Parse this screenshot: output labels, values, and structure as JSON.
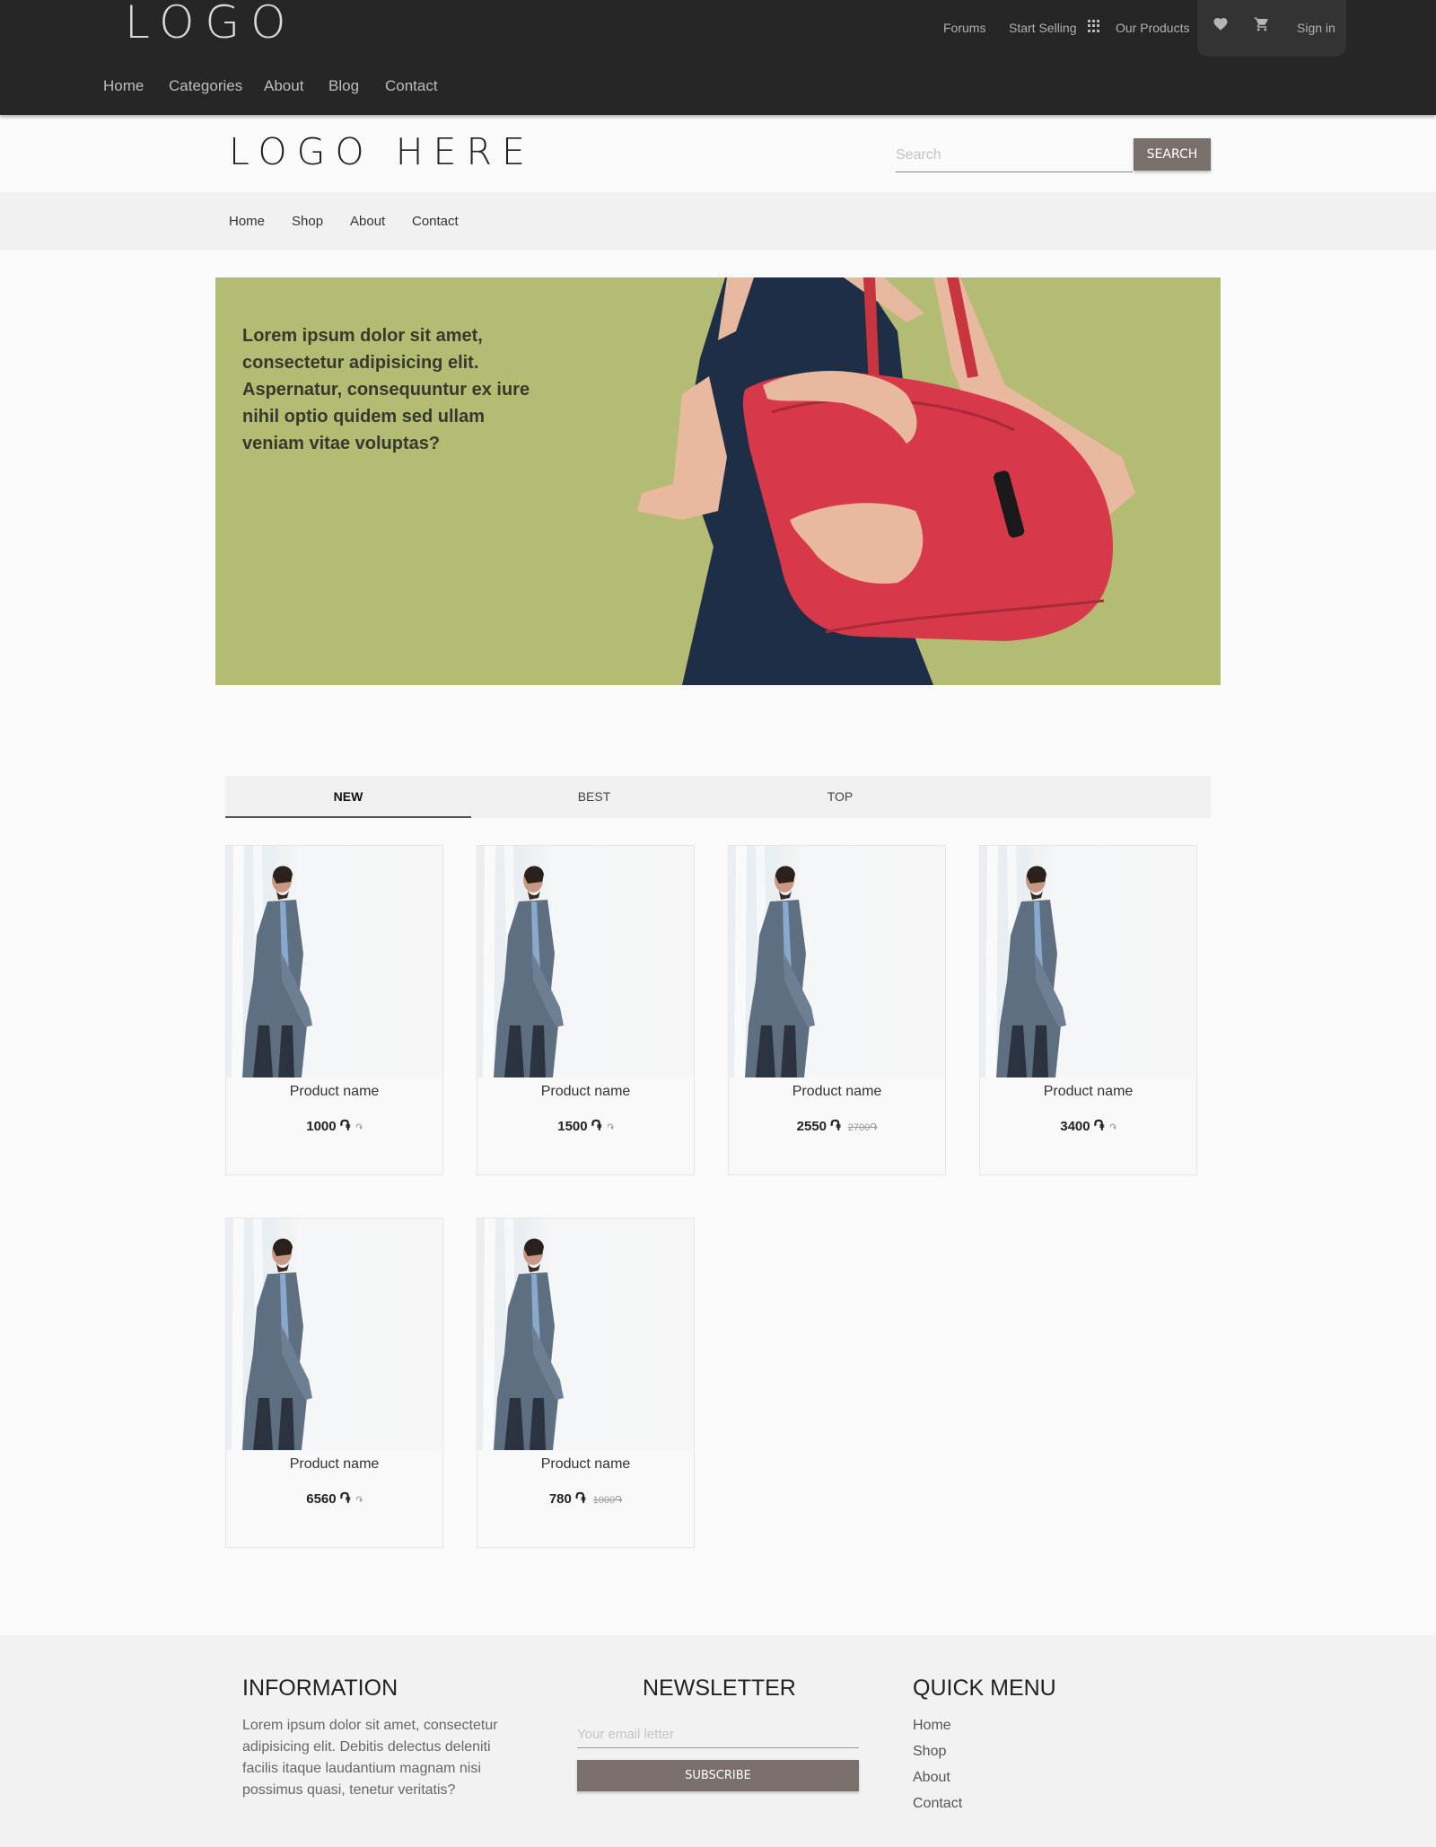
{
  "topbar": {
    "logo": "LOGO",
    "links": {
      "forums": "Forums",
      "start_selling": "Start Selling",
      "our_products": "Our Products",
      "sign_in": "Sign in"
    },
    "icons": [
      "apps-grid-icon",
      "heart-icon",
      "cart-icon"
    ],
    "nav": [
      "Home",
      "Categories",
      "About",
      "Blog",
      "Contact"
    ]
  },
  "header": {
    "logo": "LOGO HERE",
    "search_placeholder": "Search",
    "search_button": "SEARCH"
  },
  "subnav": [
    "Home",
    "Shop",
    "About",
    "Contact"
  ],
  "hero": {
    "text": "Lorem ipsum dolor sit amet, consectetur adipisicing elit. Aspernatur, consequuntur ex iure nihil optio quidem sed ullam veniam vitae voluptas?",
    "background_color": "#b4bb73"
  },
  "tabs": [
    "NEW",
    "BEST",
    "TOP"
  ],
  "active_tab": "NEW",
  "currency_symbol": "֏",
  "products": [
    {
      "name": "Product name",
      "price": "1000",
      "old_price": ""
    },
    {
      "name": "Product name",
      "price": "1500",
      "old_price": ""
    },
    {
      "name": "Product name",
      "price": "2550",
      "old_price": "2700"
    },
    {
      "name": "Product name",
      "price": "3400",
      "old_price": ""
    },
    {
      "name": "Product name",
      "price": "6560",
      "old_price": ""
    },
    {
      "name": "Product name",
      "price": "780",
      "old_price": "1000"
    }
  ],
  "footer": {
    "information": {
      "title": "INFORMATION",
      "text": "Lorem ipsum dolor sit amet, consectetur adipisicing elit. Debitis delectus deleniti facilis itaque laudantium magnam nisi possimus quasi, tenetur veritatis?"
    },
    "newsletter": {
      "title": "NEWSLETTER",
      "placeholder": "Your email letter",
      "button": "SUBSCRIBE"
    },
    "quick_menu": {
      "title": "QUICK MENU",
      "items": [
        "Home",
        "Shop",
        "About",
        "Contact"
      ]
    }
  },
  "colors": {
    "topbar": "#262626",
    "button": "#79706c",
    "hero": "#b4bb73"
  }
}
